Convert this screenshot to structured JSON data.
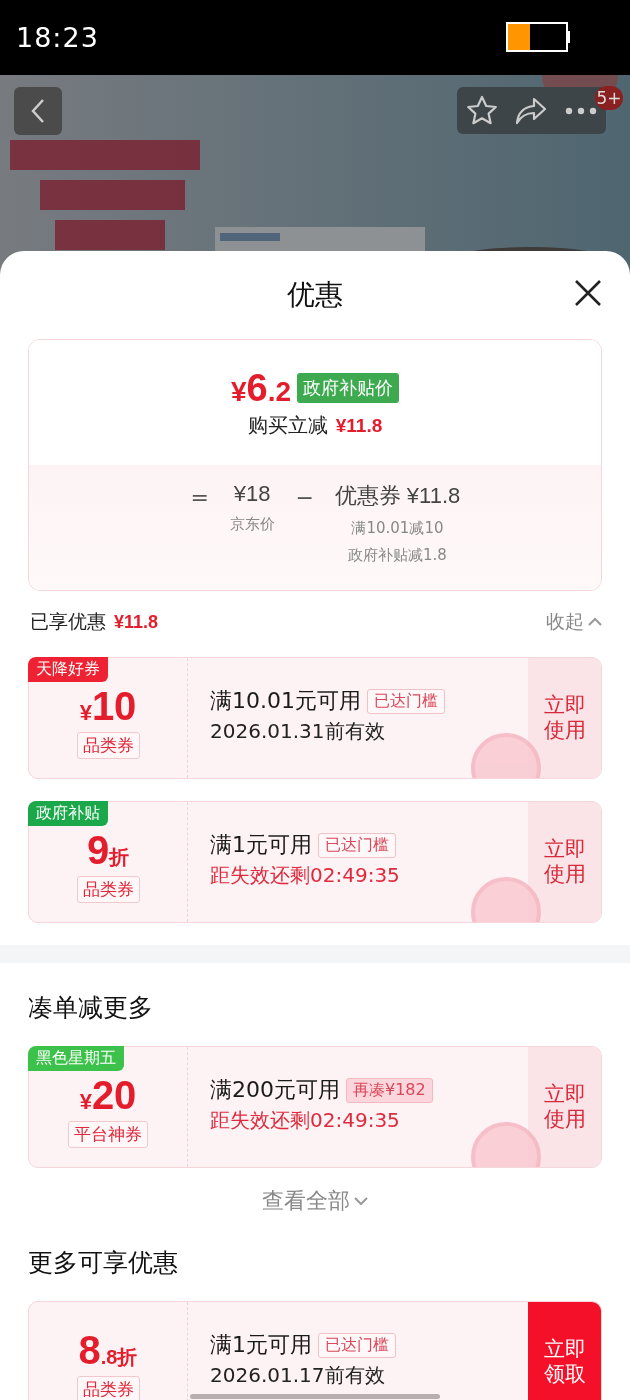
{
  "status_bar": {
    "time": "18:23"
  },
  "header": {
    "badge": "5+"
  },
  "sheet": {
    "title": "优惠"
  },
  "summary": {
    "price": {
      "currency": "¥",
      "integer": "6",
      "decimal": ".2"
    },
    "price_tag": "政府补贴价",
    "saving_label": "购买立减",
    "saving": "¥11.8",
    "formula": {
      "equals": "=",
      "base": "¥18",
      "base_label": "京东价",
      "minus": "−",
      "discount": "优惠券 ¥11.8",
      "discount_notes": [
        "满10.01减10",
        "政府补贴减1.8"
      ]
    }
  },
  "enjoyed": {
    "label": "已享优惠",
    "amount": "¥11.8",
    "toggle": "收起",
    "expanded": true
  },
  "enjoyed_coupons": [
    {
      "tag": "天降好券",
      "color": "#ee2233",
      "amount": {
        "prefix": "¥",
        "value": "10"
      },
      "category": "品类券",
      "condition": "满10.01元可用",
      "threshold": {
        "kind": "outline",
        "text": "已达门槛"
      },
      "validity": {
        "kind": "date",
        "text": "2026.01.31前有效"
      },
      "action": {
        "kind": "use",
        "text": "立即使用"
      },
      "claimed": true
    },
    {
      "tag": "政府补贴",
      "color": "#1aa84a",
      "amount": {
        "value": "9",
        "suffix": "折"
      },
      "category": "品类券",
      "condition": "满1元可用",
      "threshold": {
        "kind": "outline",
        "text": "已达门槛"
      },
      "validity": {
        "kind": "countdown",
        "text": "距失效还剩02:49:35"
      },
      "action": {
        "kind": "use",
        "text": "立即使用"
      },
      "claimed": true
    }
  ],
  "more_section": {
    "title": "凑单减更多",
    "view_all": "查看全部"
  },
  "more_coupons": [
    {
      "tag": "黑色星期五",
      "color": "#3cc24a",
      "amount": {
        "prefix": "¥",
        "value": "20"
      },
      "category": "平台神券",
      "condition": "满200元可用",
      "threshold": {
        "kind": "filled",
        "text": "再凑¥182"
      },
      "validity": {
        "kind": "countdown",
        "text": "距失效还剩02:49:35"
      },
      "action": {
        "kind": "use",
        "text": "立即使用"
      },
      "claimed": true
    }
  ],
  "extra_section": {
    "title": "更多可享优惠"
  },
  "extra_coupons": [
    {
      "amount": {
        "value": "8",
        "suffix": ".8折"
      },
      "category": "品类券",
      "condition": "满1元可用",
      "threshold": {
        "kind": "outline",
        "text": "已达门槛"
      },
      "validity": {
        "kind": "date",
        "text": "2026.01.17前有效"
      },
      "action": {
        "kind": "claim",
        "text": "立即领取"
      },
      "claimed": false
    }
  ]
}
